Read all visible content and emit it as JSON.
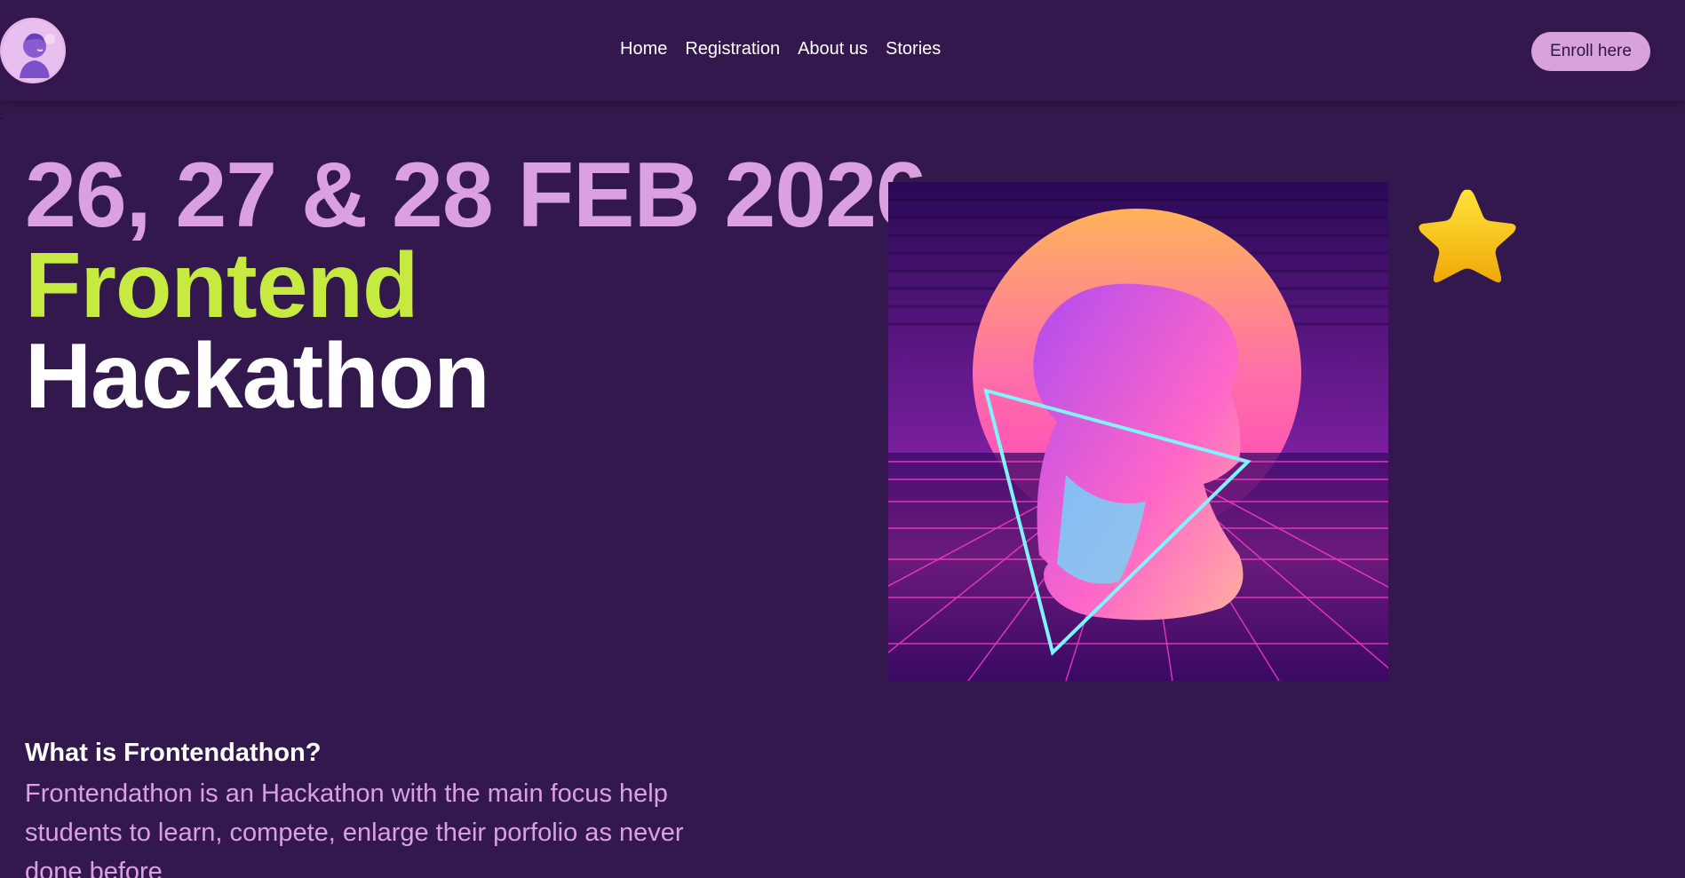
{
  "nav": {
    "links": [
      "Home",
      "Registration",
      "About us",
      "Stories"
    ],
    "enroll_label": "Enroll here"
  },
  "hero": {
    "date": "26, 27 & 28 FEB 2026",
    "title_line1": "Frontend",
    "title_line2": "Hackathon"
  },
  "about": {
    "title": "What is Frontendathon?",
    "text": "Frontendathon is an Hackathon with the main focus help students to learn, compete, enlarge their porfolio as never done before"
  },
  "colors": {
    "background": "#33184d",
    "accent_pink": "#dba0e0",
    "accent_lime": "#c6ea3f",
    "button_bg": "#d8a3dd"
  },
  "icons": {
    "logo": "david-bust-logo-icon",
    "star": "star-icon",
    "hero_image": "synthwave-david-bust-image"
  }
}
